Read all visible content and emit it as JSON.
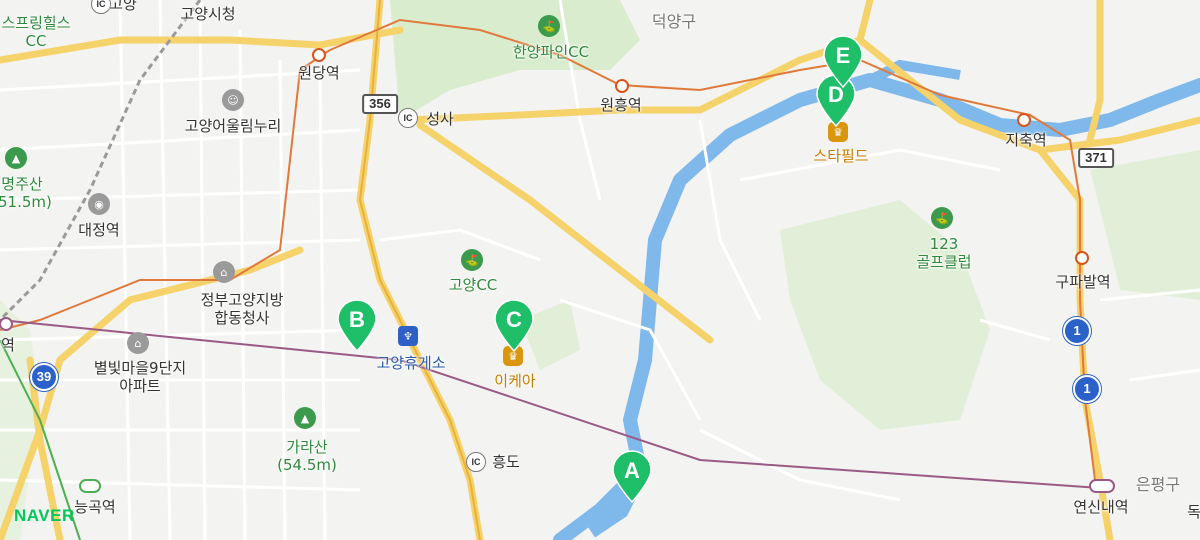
{
  "map": {
    "brand": "NAVER",
    "colors": {
      "land": "#f3f3f1",
      "park": "#d9eccd",
      "river": "#7fb8ea",
      "road_major": "#f5d26a",
      "road_minor": "#ffffff",
      "rail": "#e07a3c",
      "subway": "#9b5a86",
      "marker": "#1fbf6a"
    },
    "places": {
      "springhills": "스프링힐스\nCC",
      "goyang_cityhall": "고양시청",
      "wondang_station": "원당역",
      "hanyang_pine": "한양파인CC",
      "deogyang_gu": "덕양구",
      "wonheung_station": "원흥역",
      "seongsa": "성사",
      "goyang_oullim": "고양어울림누리",
      "myeongjusan": "명주산\n(51.5m)",
      "daejeong_station": "대정역",
      "goyang_cc": "고양CC",
      "government_complex": "정부고양지방\n합동청사",
      "starfield": "스타필드",
      "golf_club_123": "123\n골프클럽",
      "jichuk_station": "지축역",
      "gupabal_station": "구파발역",
      "goyang_rest_area": "고양휴게소",
      "ikea": "이케아",
      "byeolbit_apt": "별빛마을9단지\n아파트",
      "garasan": "가라산\n(54.5m)",
      "heungdo": "흥도",
      "neunggok_station": "능곡역",
      "yeonsinnae_station": "연신내역",
      "eunpyeong_gu": "은평구",
      "station_e_partial": "역",
      "left_edge_station": "역",
      "goyang_top": "고양",
      "right_edge": "독"
    },
    "road_shields": {
      "r356": "356",
      "r371": "371",
      "r39": "39",
      "r1a": "1",
      "r1b": "1"
    },
    "ic_label": "IC",
    "markers": [
      {
        "id": "A",
        "label": "A"
      },
      {
        "id": "B",
        "label": "B"
      },
      {
        "id": "C",
        "label": "C"
      },
      {
        "id": "D",
        "label": "D"
      },
      {
        "id": "E",
        "label": "E"
      }
    ],
    "icons": {
      "golf": "golf-icon",
      "mountain": "mountain-icon",
      "shop": "shopping-icon",
      "restaurant": "restaurant-icon",
      "government": "government-icon",
      "culture": "theater-icon",
      "train": "train-icon"
    }
  }
}
